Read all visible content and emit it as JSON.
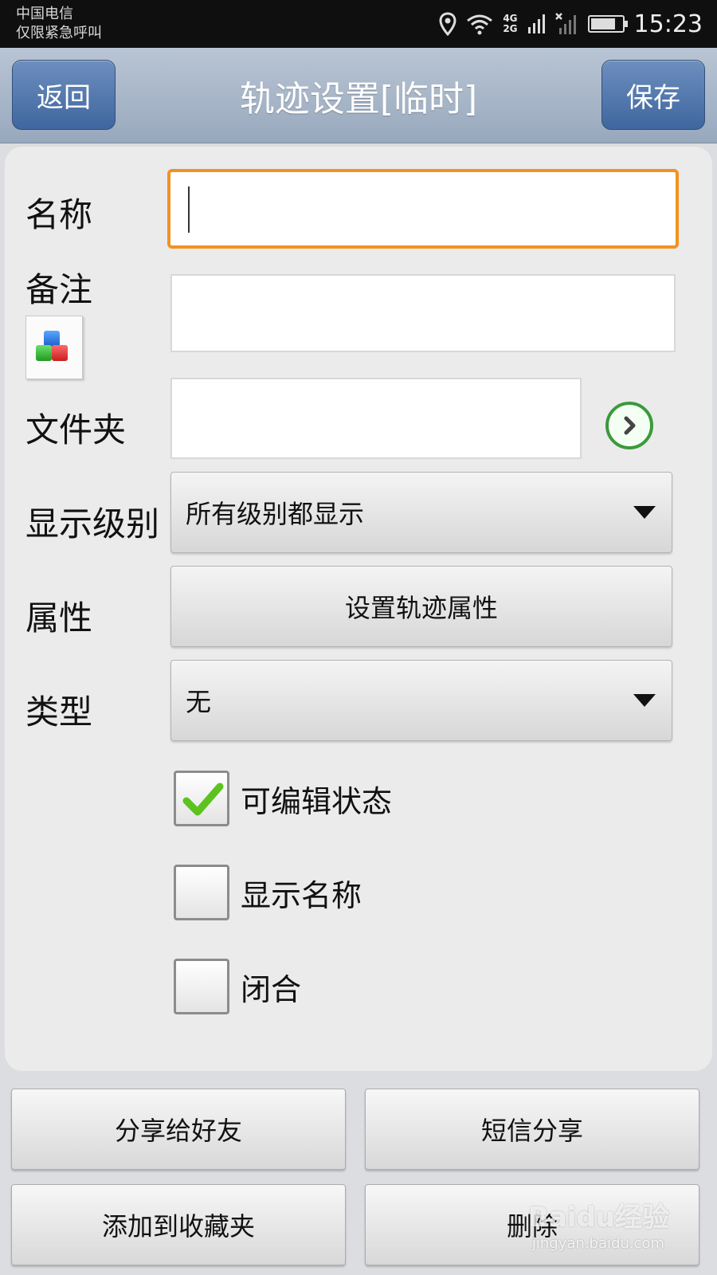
{
  "status_bar": {
    "carrier": "中国电信",
    "emergency": "仅限紧急呼叫",
    "network_top": "4G",
    "network_bottom": "2G",
    "time": "15:23"
  },
  "header": {
    "back_label": "返回",
    "title": "轨迹设置[临时]",
    "save_label": "保存"
  },
  "form": {
    "name_label": "名称",
    "name_value": "",
    "note_label": "备注",
    "note_value": "",
    "folder_label": "文件夹",
    "folder_value": "",
    "display_level_label": "显示级别",
    "display_level_value": "所有级别都显示",
    "attributes_label": "属性",
    "attributes_button": "设置轨迹属性",
    "type_label": "类型",
    "type_value": "无",
    "checkboxes": [
      {
        "label": "可编辑状态",
        "checked": true
      },
      {
        "label": "显示名称",
        "checked": false
      },
      {
        "label": "闭合",
        "checked": false
      }
    ]
  },
  "actions": {
    "share_friend": "分享给好友",
    "sms_share": "短信分享",
    "add_favorite": "添加到收藏夹",
    "delete": "删除"
  },
  "watermark": {
    "brand": "Baidu经验",
    "url": "jingyan.baidu.com"
  },
  "colors": {
    "focus_border": "#f39220",
    "nav_button": "#4a71a8",
    "check_green": "#5cc31e",
    "go_icon_green": "#3a9a3a"
  }
}
